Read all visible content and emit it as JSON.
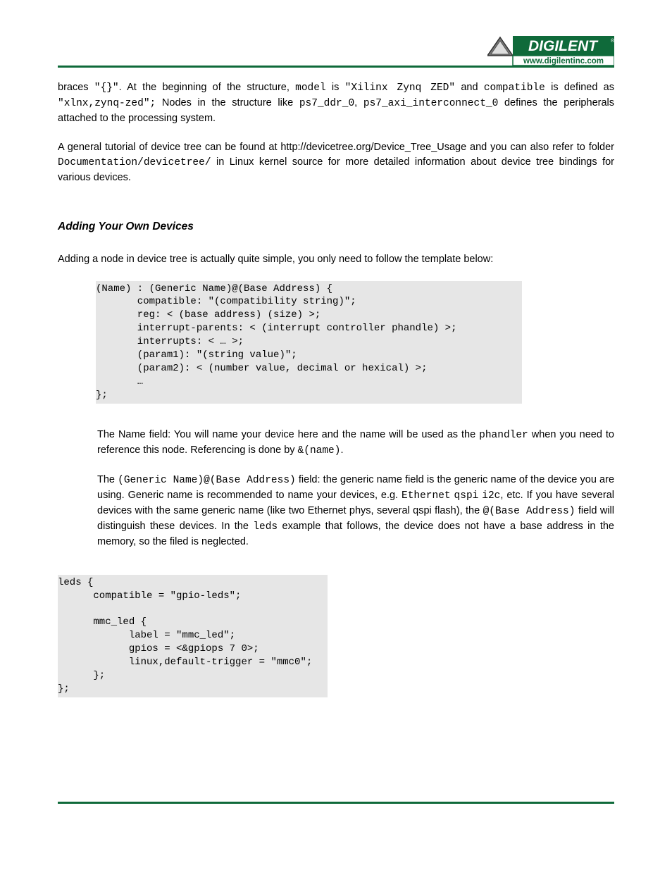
{
  "logo": {
    "brand": "DIGILENT",
    "url": "www.digilentinc.com",
    "reg": "®"
  },
  "p1_a": "braces ",
  "p1_braces": "\"{}\"",
  "p1_b": ". At the beginning of the structure, ",
  "p1_model": "model",
  "p1_c": " is ",
  "p1_modelval": "\"Xilinx Zynq ZED\"",
  "p1_d": " and ",
  "p1_compat": "compatible",
  "p1_e": " is defined as ",
  "p1_compatval": "\"xlnx,zynq-zed\";",
  "p1_f": " Nodes in the structure like ",
  "p1_node1": "ps7_ddr_0",
  "p1_g": ", ",
  "p1_node2": "ps7_axi_interconnect_0",
  "p1_h": " defines the peripherals attached to the processing system.",
  "p2_a": "A general tutorial of device tree can be found at ",
  "p2_link": "http://devicetree.org/Device_Tree_Usage",
  "p2_b": " and you can also refer to folder ",
  "p2_path": "Documentation/devicetree/",
  "p2_c": " in Linux kernel source for more detailed information about device tree bindings for various devices.",
  "section_title": "Adding Your Own Devices",
  "p3_a": "Adding a node in device tree is actually quite simple, you only need to follow the template below:",
  "codeblock1": "(Name) : (Generic Name)@(Base Address) {\n       compatible: \"(compatibility string)\";\n       reg: < (base address) (size) >;\n       interrupt-parents: < (interrupt controller phandle) >;\n       interrupts: < … >;\n       (param1): \"(string value)\";\n       (param2): < (number value, decimal or hexical) >;\n       …\n};",
  "p4_a": "The Name field: You will name your device here and the name will be used as the ",
  "p4_ph": "phandler",
  "p4_b": " when you need to reference this node. Referencing is done by ",
  "p4_ref": "&(name)",
  "p4_c": ".",
  "p5_a": "The ",
  "p5_gn": "(Generic Name)@(Base Address)",
  "p5_b": " field: the generic name field is the generic name of the device you are using. Generic name is recommended to name your devices, e.g. ",
  "p5_eth": "Ethernet",
  "p5_sp1": " ",
  "p5_qspi": "qspi",
  "p5_sp2": " ",
  "p5_i2c": "i2c",
  "p5_c": ", etc. If you have several devices with the same generic name (like two Ethernet phys, several qspi flash), the ",
  "p5_ba": "@(Base Address)",
  "p5_d": " field will distinguish these devices. In the ",
  "p5_leds": "leds",
  "p5_e": " example that follows, the device does not have a base address in the memory, so the filed is neglected.",
  "codeblock2": "leds {\n      compatible = \"gpio-leds\";\n\n      mmc_led {\n            label = \"mmc_led\";\n            gpios = <&gpiops 7 0>;\n            linux,default-trigger = \"mmc0\";\n      };\n};"
}
